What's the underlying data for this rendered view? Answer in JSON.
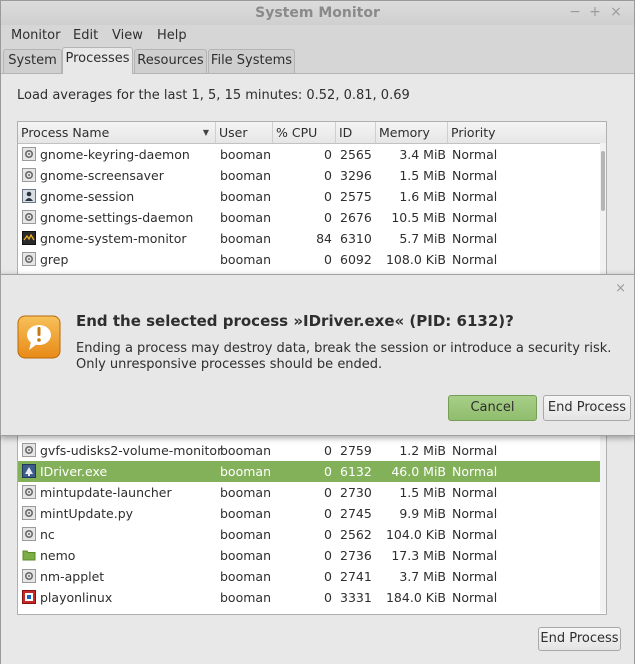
{
  "window": {
    "title": "System Monitor",
    "controls": [
      "−",
      "+",
      "×"
    ]
  },
  "menu": [
    "Monitor",
    "Edit",
    "View",
    "Help"
  ],
  "tabs": [
    {
      "label": "System",
      "active": false
    },
    {
      "label": "Processes",
      "active": true
    },
    {
      "label": "Resources",
      "active": false
    },
    {
      "label": "File Systems",
      "active": false
    }
  ],
  "load_averages": "Load averages for the last 1, 5, 15 minutes: 0.52, 0.81, 0.69",
  "table": {
    "columns": [
      "Process Name",
      "User",
      "% CPU",
      "ID",
      "Memory",
      "Priority"
    ],
    "rows_top": [
      {
        "name": "gnome-keyring-daemon",
        "user": "booman",
        "cpu": "0",
        "id": "2565",
        "mem": "3.4 MiB",
        "pri": "Normal",
        "icon": "gear"
      },
      {
        "name": "gnome-screensaver",
        "user": "booman",
        "cpu": "0",
        "id": "3296",
        "mem": "1.5 MiB",
        "pri": "Normal",
        "icon": "gear"
      },
      {
        "name": "gnome-session",
        "user": "booman",
        "cpu": "0",
        "id": "2575",
        "mem": "1.6 MiB",
        "pri": "Normal",
        "icon": "session"
      },
      {
        "name": "gnome-settings-daemon",
        "user": "booman",
        "cpu": "0",
        "id": "2676",
        "mem": "10.5 MiB",
        "pri": "Normal",
        "icon": "gear"
      },
      {
        "name": "gnome-system-monitor",
        "user": "booman",
        "cpu": "84",
        "id": "6310",
        "mem": "5.7 MiB",
        "pri": "Normal",
        "icon": "monitor"
      },
      {
        "name": "grep",
        "user": "booman",
        "cpu": "0",
        "id": "6092",
        "mem": "108.0 KiB",
        "pri": "Normal",
        "icon": "gear"
      }
    ],
    "rows_bottom": [
      {
        "name": "gvfs-udisks2-volume-monitor",
        "user": "booman",
        "cpu": "0",
        "id": "2759",
        "mem": "1.2 MiB",
        "pri": "Normal",
        "icon": "gear",
        "selected": false
      },
      {
        "name": "IDriver.exe",
        "user": "booman",
        "cpu": "0",
        "id": "6132",
        "mem": "46.0 MiB",
        "pri": "Normal",
        "icon": "wine",
        "selected": true
      },
      {
        "name": "mintupdate-launcher",
        "user": "booman",
        "cpu": "0",
        "id": "2730",
        "mem": "1.5 MiB",
        "pri": "Normal",
        "icon": "gear",
        "selected": false
      },
      {
        "name": "mintUpdate.py",
        "user": "booman",
        "cpu": "0",
        "id": "2745",
        "mem": "9.9 MiB",
        "pri": "Normal",
        "icon": "gear",
        "selected": false
      },
      {
        "name": "nc",
        "user": "booman",
        "cpu": "0",
        "id": "2562",
        "mem": "104.0 KiB",
        "pri": "Normal",
        "icon": "gear",
        "selected": false
      },
      {
        "name": "nemo",
        "user": "booman",
        "cpu": "0",
        "id": "2736",
        "mem": "17.3 MiB",
        "pri": "Normal",
        "icon": "folder",
        "selected": false
      },
      {
        "name": "nm-applet",
        "user": "booman",
        "cpu": "0",
        "id": "2741",
        "mem": "3.7 MiB",
        "pri": "Normal",
        "icon": "gear",
        "selected": false
      },
      {
        "name": "playonlinux",
        "user": "booman",
        "cpu": "0",
        "id": "3331",
        "mem": "184.0 KiB",
        "pri": "Normal",
        "icon": "pol",
        "selected": false
      }
    ]
  },
  "end_process_button": "End Process",
  "dialog": {
    "title": "End the selected process »IDriver.exe« (PID: 6132)?",
    "message": "Ending a process may destroy data, break the session or introduce a security risk. Only unresponsive processes should be ended.",
    "cancel_label": "Cancel",
    "confirm_label": "End Process",
    "close_glyph": "×"
  },
  "colors": {
    "selection": "#83b15a",
    "accent_button": "#9ec67c",
    "warning_icon": "#f0a030"
  }
}
